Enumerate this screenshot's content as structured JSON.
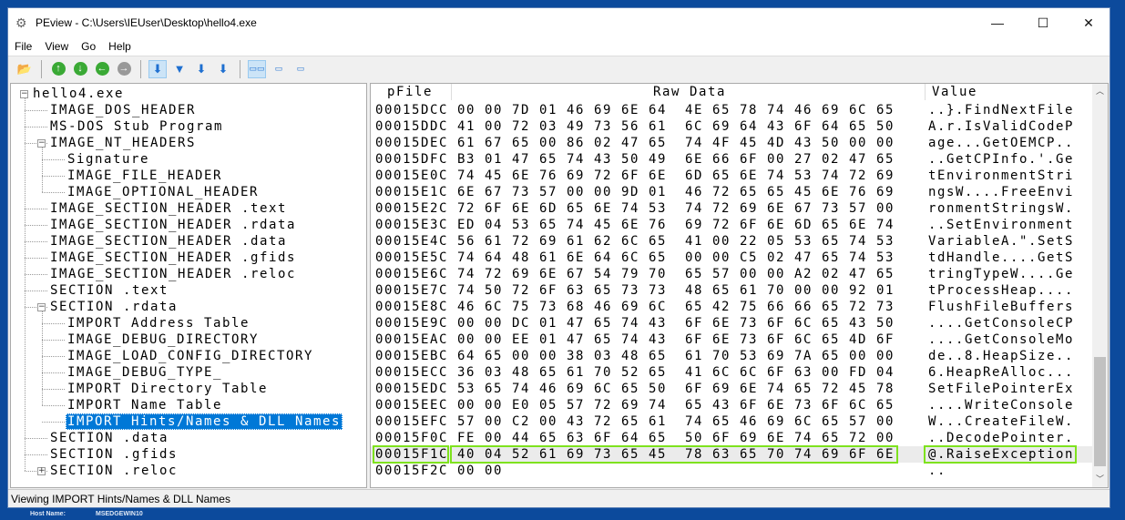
{
  "window": {
    "title": "PEview - C:\\Users\\IEUser\\Desktop\\hello4.exe",
    "minimize": "—",
    "maximize": "☐",
    "close": "✕"
  },
  "menu": [
    "File",
    "View",
    "Go",
    "Help"
  ],
  "toolbar": [
    "open-icon",
    "up-icon",
    "down-icon",
    "back-icon",
    "forward-icon",
    "view-1-icon",
    "view-2-icon",
    "view-3-icon",
    "view-4-icon",
    "bytes-wide-icon",
    "bytes-medium-icon",
    "bytes-narrow-icon"
  ],
  "tree": [
    {
      "label": "hello4.exe",
      "level": 0,
      "exp": "-"
    },
    {
      "label": "IMAGE_DOS_HEADER",
      "level": 1
    },
    {
      "label": "MS-DOS Stub Program",
      "level": 1
    },
    {
      "label": "IMAGE_NT_HEADERS",
      "level": 1,
      "exp": "-"
    },
    {
      "label": "Signature",
      "level": 2
    },
    {
      "label": "IMAGE_FILE_HEADER",
      "level": 2
    },
    {
      "label": "IMAGE_OPTIONAL_HEADER",
      "level": 2
    },
    {
      "label": "IMAGE_SECTION_HEADER .text",
      "level": 1
    },
    {
      "label": "IMAGE_SECTION_HEADER .rdata",
      "level": 1
    },
    {
      "label": "IMAGE_SECTION_HEADER .data",
      "level": 1
    },
    {
      "label": "IMAGE_SECTION_HEADER .gfids",
      "level": 1
    },
    {
      "label": "IMAGE_SECTION_HEADER .reloc",
      "level": 1
    },
    {
      "label": "SECTION .text",
      "level": 1
    },
    {
      "label": "SECTION .rdata",
      "level": 1,
      "exp": "-"
    },
    {
      "label": "IMPORT Address Table",
      "level": 2
    },
    {
      "label": "IMAGE_DEBUG_DIRECTORY",
      "level": 2
    },
    {
      "label": "IMAGE_LOAD_CONFIG_DIRECTORY",
      "level": 2
    },
    {
      "label": "IMAGE_DEBUG_TYPE_",
      "level": 2
    },
    {
      "label": "IMPORT Directory Table",
      "level": 2
    },
    {
      "label": "IMPORT Name Table",
      "level": 2
    },
    {
      "label": "IMPORT Hints/Names & DLL Names",
      "level": 2,
      "selected": true
    },
    {
      "label": "SECTION .data",
      "level": 1
    },
    {
      "label": "SECTION .gfids",
      "level": 1
    },
    {
      "label": "SECTION .reloc",
      "level": 1,
      "exp": "+"
    }
  ],
  "columns": {
    "pfile": "pFile",
    "raw": "Raw Data",
    "value": "Value"
  },
  "rows": [
    {
      "off": "00015DCC",
      "hex": "00 00 7D 01 46 69 6E 64  4E 65 78 74 46 69 6C 65",
      "val": "..}.FindNextFile"
    },
    {
      "off": "00015DDC",
      "hex": "41 00 72 03 49 73 56 61  6C 69 64 43 6F 64 65 50",
      "val": "A.r.IsValidCodeP"
    },
    {
      "off": "00015DEC",
      "hex": "61 67 65 00 86 02 47 65  74 4F 45 4D 43 50 00 00",
      "val": "age...GetOEMCP.."
    },
    {
      "off": "00015DFC",
      "hex": "B3 01 47 65 74 43 50 49  6E 66 6F 00 27 02 47 65",
      "val": "..GetCPInfo.'.Ge"
    },
    {
      "off": "00015E0C",
      "hex": "74 45 6E 76 69 72 6F 6E  6D 65 6E 74 53 74 72 69",
      "val": "tEnvironmentStri"
    },
    {
      "off": "00015E1C",
      "hex": "6E 67 73 57 00 00 9D 01  46 72 65 65 45 6E 76 69",
      "val": "ngsW....FreeEnvi"
    },
    {
      "off": "00015E2C",
      "hex": "72 6F 6E 6D 65 6E 74 53  74 72 69 6E 67 73 57 00",
      "val": "ronmentStringsW."
    },
    {
      "off": "00015E3C",
      "hex": "ED 04 53 65 74 45 6E 76  69 72 6F 6E 6D 65 6E 74",
      "val": "..SetEnvironment"
    },
    {
      "off": "00015E4C",
      "hex": "56 61 72 69 61 62 6C 65  41 00 22 05 53 65 74 53",
      "val": "VariableA.\".SetS"
    },
    {
      "off": "00015E5C",
      "hex": "74 64 48 61 6E 64 6C 65  00 00 C5 02 47 65 74 53",
      "val": "tdHandle....GetS"
    },
    {
      "off": "00015E6C",
      "hex": "74 72 69 6E 67 54 79 70  65 57 00 00 A2 02 47 65",
      "val": "tringTypeW....Ge"
    },
    {
      "off": "00015E7C",
      "hex": "74 50 72 6F 63 65 73 73  48 65 61 70 00 00 92 01",
      "val": "tProcessHeap...."
    },
    {
      "off": "00015E8C",
      "hex": "46 6C 75 73 68 46 69 6C  65 42 75 66 66 65 72 73",
      "val": "FlushFileBuffers"
    },
    {
      "off": "00015E9C",
      "hex": "00 00 DC 01 47 65 74 43  6F 6E 73 6F 6C 65 43 50",
      "val": "....GetConsoleCP"
    },
    {
      "off": "00015EAC",
      "hex": "00 00 EE 01 47 65 74 43  6F 6E 73 6F 6C 65 4D 6F",
      "val": "....GetConsoleMo"
    },
    {
      "off": "00015EBC",
      "hex": "64 65 00 00 38 03 48 65  61 70 53 69 7A 65 00 00",
      "val": "de..8.HeapSize.."
    },
    {
      "off": "00015ECC",
      "hex": "36 03 48 65 61 70 52 65  41 6C 6C 6F 63 00 FD 04",
      "val": "6.HeapReAlloc..."
    },
    {
      "off": "00015EDC",
      "hex": "53 65 74 46 69 6C 65 50  6F 69 6E 74 65 72 45 78",
      "val": "SetFilePointerEx"
    },
    {
      "off": "00015EEC",
      "hex": "00 00 E0 05 57 72 69 74  65 43 6F 6E 73 6F 6C 65",
      "val": "....WriteConsole"
    },
    {
      "off": "00015EFC",
      "hex": "57 00 C2 00 43 72 65 61  74 65 46 69 6C 65 57 00",
      "val": "W...CreateFileW."
    },
    {
      "off": "00015F0C",
      "hex": "FE 00 44 65 63 6F 64 65  50 6F 69 6E 74 65 72 00",
      "val": "..DecodePointer."
    },
    {
      "off": "00015F1C",
      "hex": "40 04 52 61 69 73 65 45  78 63 65 70 74 69 6F 6E",
      "val": "@.RaiseException",
      "highlight": true
    },
    {
      "off": "00015F2C",
      "hex": "00 00",
      "val": ".."
    }
  ],
  "status": "Viewing IMPORT Hints/Names & DLL Names",
  "desktop": {
    "host_label": "Host Name:",
    "host_value": "MSEDGEWIN10"
  },
  "colors": {
    "highlight_box": "#7ee21e",
    "selection": "#0078d7"
  }
}
